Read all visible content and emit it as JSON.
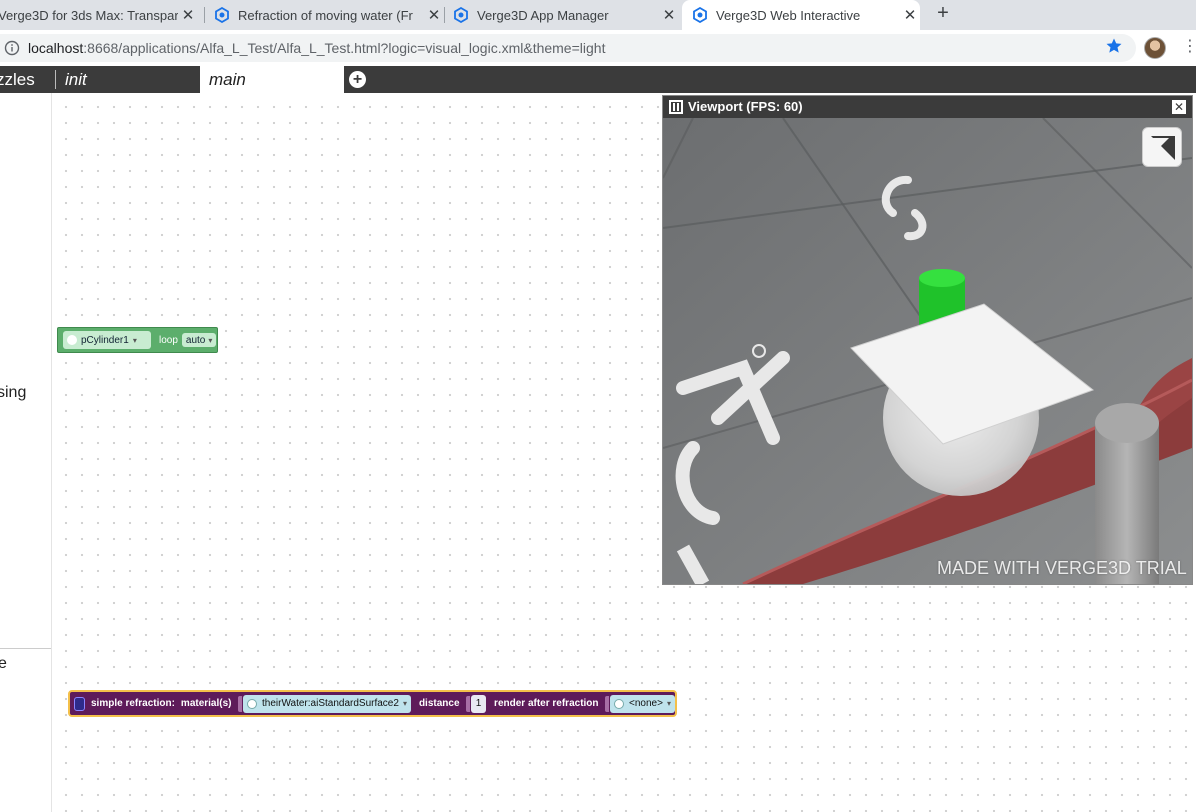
{
  "browser": {
    "tabs": [
      {
        "title": "Verge3D for 3ds Max: Transpar",
        "active": false
      },
      {
        "title": "Refraction of moving water (Fr",
        "active": false
      },
      {
        "title": "Verge3D App Manager",
        "active": false
      },
      {
        "title": "Verge3D Web Interactive",
        "active": true
      }
    ],
    "close_glyph": "✕",
    "new_tab_glyph": "+",
    "url_host": "localhost",
    "url_rest": ":8668/applications/Alfa_L_Test/Alfa_L_Test.html?logic=visual_logic.xml&theme=light",
    "favicon_color": "#1a73e8",
    "star_color": "#1a73e8"
  },
  "editor": {
    "title_fragment": "zzles",
    "tabs": [
      {
        "label": "init"
      },
      {
        "label": "main"
      }
    ],
    "add_tab_glyph": "+",
    "sidebar_fragment_1": "sing",
    "sidebar_fragment_2": "e"
  },
  "blocks": {
    "play_animation": {
      "object": "pCylinder1",
      "loop_label": "loop",
      "loop_value": "auto",
      "color": "#5cae6c"
    },
    "simple_refraction": {
      "title": "simple refraction:",
      "materials_label": "material(s)",
      "material": "theirWater:aiStandardSurface2",
      "distance_label": "distance",
      "distance": "1",
      "render_after_label": "render after refraction",
      "render_after_value": "<none>",
      "color": "#5e1b5a",
      "highlight_color": "#f4c04a"
    }
  },
  "viewport": {
    "title": "Viewport (FPS: 60)",
    "close_glyph": "✕",
    "watermark": "MADE WITH VERGE3D TRIAL"
  }
}
